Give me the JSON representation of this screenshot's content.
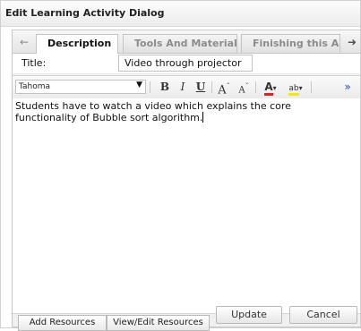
{
  "dialog": {
    "title": "Edit Learning Activity Dialog"
  },
  "tabs": [
    {
      "label": "Description",
      "active": true
    },
    {
      "label": "Tools And Materials",
      "active": false
    },
    {
      "label": "Finishing this Activi",
      "active": false
    }
  ],
  "tab_scroll": {
    "left_icon": "arrow-left-icon",
    "right_icon": "arrow-right-icon",
    "left_glyph": "←",
    "right_glyph": "➜"
  },
  "form": {
    "title_label": "Title:",
    "title_value": "Video through projector"
  },
  "toolbar": {
    "font_name": "Tahoma",
    "font_arrow": "▼",
    "bold": "B",
    "italic": "I",
    "underline": "U",
    "grow_font": "A",
    "grow_mark": "ˆ",
    "shrink_font": "A",
    "shrink_mark": "ˇ",
    "font_color": "A",
    "highlight": "ab",
    "dropdown_glyph": "▾",
    "more": "»",
    "font_color_swatch": "#e02020",
    "highlight_swatch": "#f5e600"
  },
  "editor": {
    "content": "Students have to watch a video which explains the core functionality of Bubble sort algorithm."
  },
  "resources": {
    "add_label": "Add Resources",
    "view_label": "View/Edit Resources"
  },
  "footer": {
    "update_label": "Update",
    "cancel_label": "Cancel"
  }
}
